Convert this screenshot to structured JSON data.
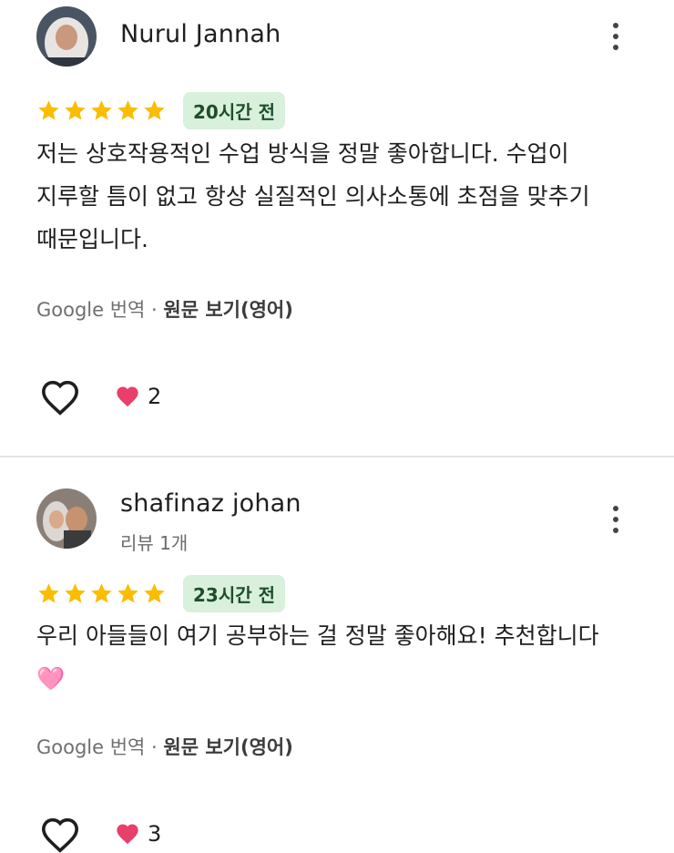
{
  "reviews": [
    {
      "author": "Nurul Jannah",
      "meta": "",
      "rating": 5,
      "time": "20시간 전",
      "text_lines": [
        "저는 상호작용적인 수업 방식을 정말 좋아합니다. 수업이",
        "지루할 틈이 없고 항상 실질적인 의사소통에 초점을 맞추기",
        "때문입니다."
      ],
      "translate_prefix": "Google 번역 · ",
      "translate_link": "원문 보기(영어)",
      "reaction_count": "2"
    },
    {
      "author": "shafinaz johan",
      "meta": "리뷰 1개",
      "rating": 5,
      "time": "23시간 전",
      "text_lines": [
        "우리 아들들이 여기 공부하는 걸 정말 좋아해요! 추천합니다",
        "🩷"
      ],
      "translate_prefix": "Google 번역 · ",
      "translate_link": "원문 보기(영어)",
      "reaction_count": "3"
    }
  ],
  "colors": {
    "star": "#fbbc04",
    "badge_bg": "#d8f0dc",
    "heart_red": "#e8406a"
  },
  "icons": {
    "star": "star-icon",
    "more": "more-vert-icon",
    "like": "heart-outline-icon",
    "reaction": "red-heart-icon"
  }
}
